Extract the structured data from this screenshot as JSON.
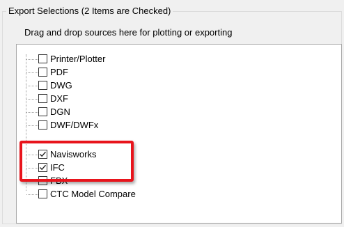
{
  "group": {
    "title": "Export Selections (2 Items are Checked)"
  },
  "hint": "Drag and drop sources here for plotting or exporting",
  "tree": {
    "items": [
      {
        "label": "Printer/Plotter",
        "checked": false
      },
      {
        "label": "PDF",
        "checked": false
      },
      {
        "label": "DWG",
        "checked": false
      },
      {
        "label": "DXF",
        "checked": false
      },
      {
        "label": "DGN",
        "checked": false
      },
      {
        "label": "DWF/DWFx",
        "checked": false
      },
      {
        "label": "Navisworks",
        "checked": true
      },
      {
        "label": "IFC",
        "checked": true
      },
      {
        "label": "FBX",
        "checked": false
      },
      {
        "label": "CTC Model Compare",
        "checked": false
      }
    ]
  },
  "annotation": {
    "color": "#e8141c"
  }
}
